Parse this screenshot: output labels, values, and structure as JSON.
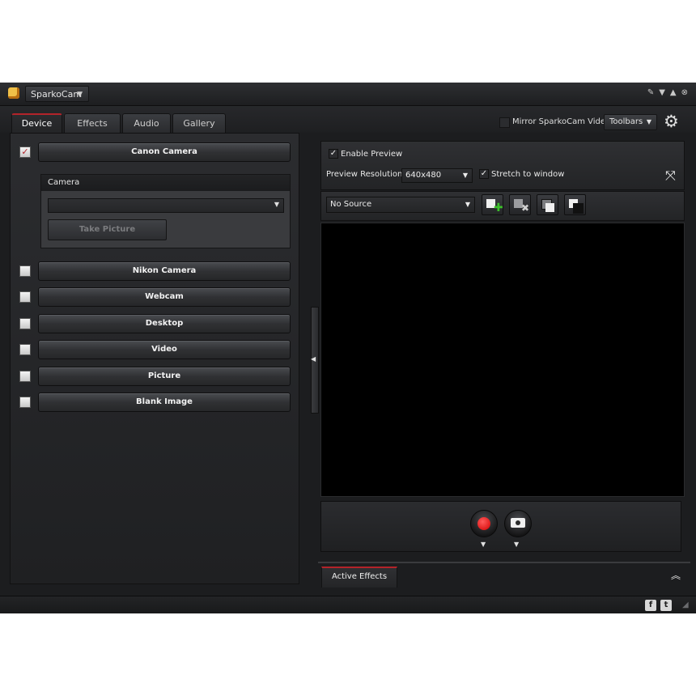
{
  "app": {
    "name": "SparkoCam"
  },
  "tabs": [
    {
      "label": "Device",
      "active": true
    },
    {
      "label": "Effects",
      "active": false
    },
    {
      "label": "Audio",
      "active": false
    },
    {
      "label": "Gallery",
      "active": false
    }
  ],
  "header": {
    "mirror_label": "Mirror SparkoCam Video",
    "mirror_checked": false,
    "toolbars_label": "Toolbars"
  },
  "sources": {
    "canon": {
      "label": "Canon Camera",
      "checked": true
    },
    "camera_section_label": "Camera",
    "camera_select_value": "",
    "take_picture_label": "Take Picture",
    "others": [
      {
        "label": "Nikon Camera",
        "checked": false
      },
      {
        "label": "Webcam",
        "checked": false
      },
      {
        "label": "Desktop",
        "checked": false
      },
      {
        "label": "Video",
        "checked": false
      },
      {
        "label": "Picture",
        "checked": false
      },
      {
        "label": "Blank Image",
        "checked": false
      }
    ]
  },
  "preview": {
    "enable_label": "Enable Preview",
    "enable_checked": true,
    "resolution_label": "Preview Resolution:",
    "resolution_value": "640x480",
    "stretch_label": "Stretch to window",
    "stretch_checked": true,
    "source_value": "No Source"
  },
  "bottom": {
    "active_effects_label": "Active Effects"
  },
  "colors": {
    "accent_red": "#b3232a",
    "record_red": "#d10000",
    "add_green": "#3cbf2a"
  },
  "icons": [
    "app-logo-icon",
    "pin-icon",
    "minimize-icon",
    "maximize-icon",
    "close-icon",
    "gear-icon",
    "fullscreen-icon",
    "add-source-icon",
    "remove-source-icon",
    "layer-top-icon",
    "layer-bottom-icon",
    "record-icon",
    "snapshot-icon",
    "facebook-icon",
    "twitter-icon"
  ]
}
